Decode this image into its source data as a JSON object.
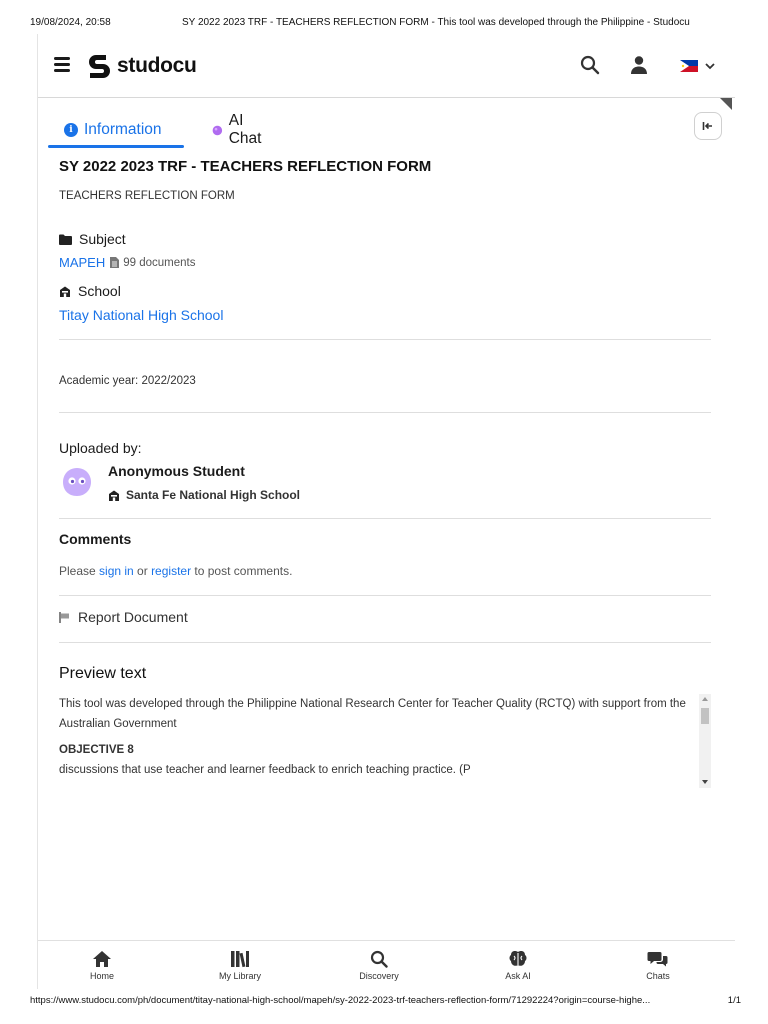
{
  "print_header": {
    "datetime": "19/08/2024, 20:58",
    "page_title": "SY 2022 2023 TRF - TEACHERS REFLECTION FORM - This tool was developed through the Philippine - Studocu"
  },
  "print_footer": {
    "url": "https://www.studocu.com/ph/document/titay-national-high-school/mapeh/sy-2022-2023-trf-teachers-reflection-form/71292224?origin=course-highe...",
    "page": "1/1"
  },
  "header": {
    "logo_text": "studocu",
    "icons": [
      "menu-icon",
      "search-icon",
      "user-icon",
      "philippines-flag-icon",
      "chevron-down-icon"
    ]
  },
  "tabs": [
    {
      "label": "Information",
      "active": true
    },
    {
      "label": "AI Chat",
      "active": false
    }
  ],
  "document": {
    "title": "SY 2022 2023 TRF - TEACHERS REFLECTION FORM",
    "description": "TEACHERS REFLECTION FORM",
    "subject_label": "Subject",
    "subject_value": "MAPEH",
    "subject_doc_count": "99 documents",
    "school_label": "School",
    "school_value": "Titay National High School",
    "academic_year": "Academic year: 2022/2023"
  },
  "uploader": {
    "heading": "Uploaded by:",
    "name": "Anonymous Student",
    "school": "Santa Fe National High School"
  },
  "comments": {
    "heading": "Comments",
    "prefix": "Please ",
    "sign_in": "sign in",
    "middle": " or ",
    "register": "register",
    "suffix": " to post comments."
  },
  "report": {
    "label": "Report Document"
  },
  "preview": {
    "heading": "Preview text",
    "paragraph": "This tool was developed through the Philippine National Research Center for Teacher Quality (RCTQ) with support from the Australian Government",
    "objective": "OBJECTIVE 8",
    "line": "discussions that use teacher and learner feedback to enrich teaching practice. (P"
  },
  "bottom_nav": [
    {
      "label": "Home",
      "icon": "home-icon"
    },
    {
      "label": "My Library",
      "icon": "library-icon"
    },
    {
      "label": "Discovery",
      "icon": "search-icon"
    },
    {
      "label": "Ask AI",
      "icon": "brain-icon"
    },
    {
      "label": "Chats",
      "icon": "chat-icon"
    }
  ],
  "colors": {
    "accent": "#1a73e8",
    "text": "#1b1b1b",
    "divider": "#dedede"
  }
}
